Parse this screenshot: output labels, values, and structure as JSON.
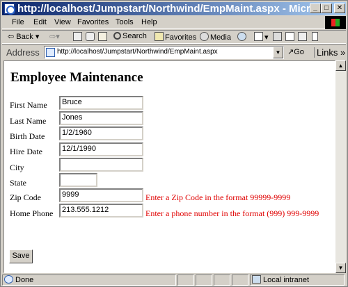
{
  "window": {
    "title": "http://localhost/Jumpstart/Northwind/EmpMaint.aspx - Micros...",
    "min_glyph": "0",
    "max_glyph": "□",
    "close_glyph": "✕"
  },
  "menu": {
    "items": [
      "File",
      "Edit",
      "View",
      "Favorites",
      "Tools",
      "Help"
    ]
  },
  "toolbar": {
    "back_label": "Back",
    "back_arrow": "⇦",
    "forward_arrow": "⇨",
    "search_label": "Search",
    "favorites_label": "Favorites",
    "media_label": "Media"
  },
  "address": {
    "label": "Address",
    "url": "http://localhost/Jumpstart/Northwind/EmpMaint.aspx",
    "go_label": "Go",
    "links_label": "Links"
  },
  "page": {
    "title": "Employee Maintenance",
    "fields": {
      "first_name": {
        "label": "First Name",
        "value": "Bruce"
      },
      "last_name": {
        "label": "Last Name",
        "value": "Jones"
      },
      "birth_date": {
        "label": "Birth Date",
        "value": "1/2/1960"
      },
      "hire_date": {
        "label": "Hire Date",
        "value": "12/1/1990"
      },
      "city": {
        "label": "City",
        "value": ""
      },
      "state": {
        "label": "State",
        "value": ""
      },
      "zip_code": {
        "label": "Zip Code",
        "value": "9999"
      },
      "home_phone": {
        "label": "Home Phone",
        "value": "213.555.1212"
      }
    },
    "errors": {
      "zip_code": "Enter a Zip Code in the format 99999-9999",
      "home_phone": "Enter a phone number in the format (999) 999-9999"
    },
    "save_label": "Save"
  },
  "status": {
    "text": "Done",
    "zone": "Local intranet"
  },
  "colors": {
    "error": "#e00000",
    "titlebar_start": "#0a246a",
    "titlebar_end": "#a6caf0",
    "chrome": "#d4d0c8"
  },
  "icons": [
    "ie-logo-icon",
    "back-arrow-icon",
    "forward-arrow-icon",
    "stop-icon",
    "refresh-icon",
    "home-icon",
    "search-icon",
    "favorites-icon",
    "media-icon",
    "history-icon",
    "mail-icon",
    "print-icon",
    "edit-icon",
    "discuss-icon",
    "page-icon",
    "go-arrow-icon",
    "windows-logo-icon",
    "local-intranet-icon"
  ]
}
